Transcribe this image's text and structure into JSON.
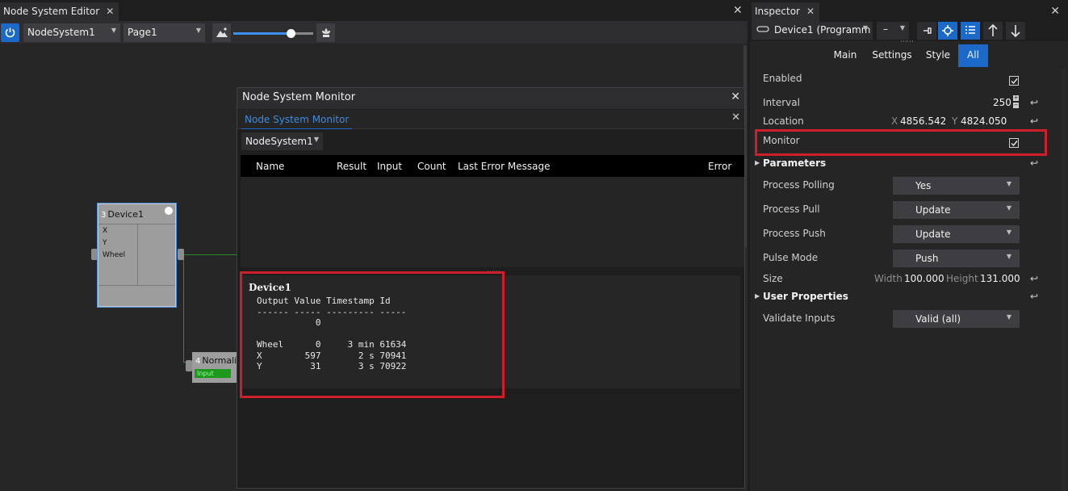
{
  "editor": {
    "tab_label": "Node System Editor",
    "nodesystem_value": "NodeSystem1",
    "page_value": "Page1",
    "zoom_fraction": 0.72,
    "nodes": [
      {
        "num": "3",
        "name": "Device1",
        "ports": [
          "X",
          "Y",
          "Wheel"
        ]
      },
      {
        "num": "4",
        "name": "Normaliz",
        "input_label": "Input"
      }
    ]
  },
  "monitor": {
    "title": "Node System Monitor",
    "tab_label": "Node System Monitor",
    "system_value": "NodeSystem1",
    "columns": [
      "Name",
      "Result",
      "Input",
      "Count",
      "Last Error Message",
      "Error"
    ],
    "detail_title": "Device1",
    "detail_text": "Output Value Timestamp Id\n------ ----- --------- -----\n           0\n\nWheel      0     3 min 61634\nX        597       2 s 70941\nY         31       3 s 70922"
  },
  "inspector": {
    "tab_label": "Inspector",
    "object_value": "Device1 (Programm",
    "mini_value": "–",
    "filter_tabs": [
      "Main",
      "Settings",
      "Style",
      "All"
    ],
    "active_filter": "All",
    "properties": {
      "enabled_label": "Enabled",
      "enabled_checked": true,
      "interval_label": "Interval",
      "interval_value": "250",
      "location_label": "Location",
      "location_x_label": "X",
      "location_x": "4856.542",
      "location_y_label": "Y",
      "location_y": "4824.050",
      "monitor_label": "Monitor",
      "monitor_checked": true,
      "parameters_label": "Parameters",
      "process_polling_label": "Process Polling",
      "process_polling_value": "Yes",
      "process_pull_label": "Process Pull",
      "process_pull_value": "Update",
      "process_push_label": "Process Push",
      "process_push_value": "Update",
      "pulse_mode_label": "Pulse Mode",
      "pulse_mode_value": "Push",
      "size_label": "Size",
      "width_label": "Width",
      "width_value": "100.000",
      "height_label": "Height",
      "height_value": "131.000",
      "user_properties_label": "User Properties",
      "validate_inputs_label": "Validate Inputs",
      "validate_inputs_value": "Valid (all)"
    }
  },
  "colors": {
    "accent": "#1b6ac9",
    "highlight_box": "#d01f2a",
    "wire": "#2d8c2d"
  },
  "icons": [
    "power-icon",
    "close-icon",
    "chevron-down-icon",
    "mountain-icon",
    "flower-icon",
    "pin-icon",
    "target-icon",
    "list-icon",
    "arrow-up-icon",
    "arrow-down-icon",
    "checkmark-icon",
    "reset-arrow-icon",
    "device-icon"
  ]
}
